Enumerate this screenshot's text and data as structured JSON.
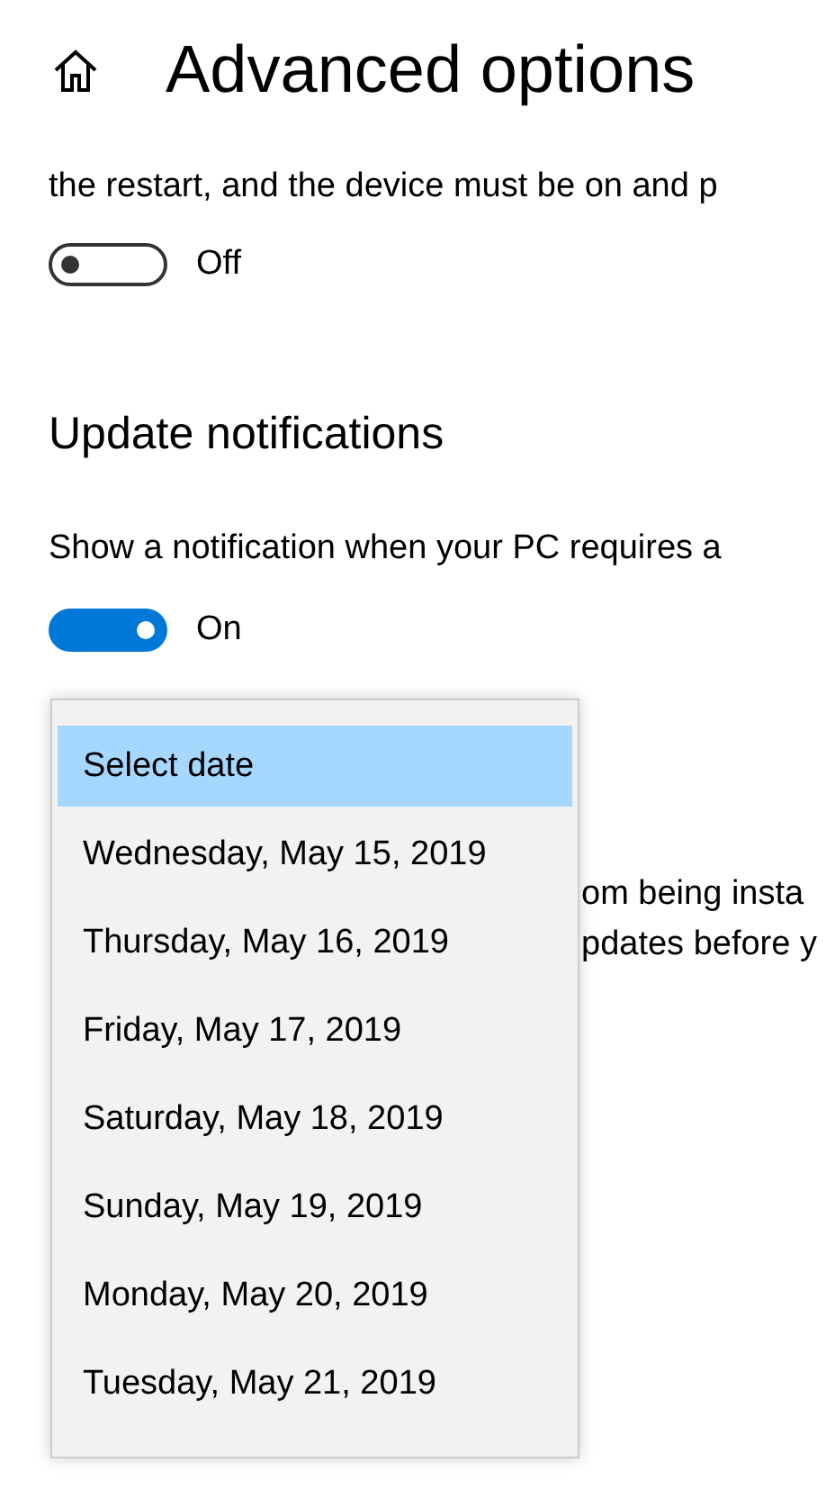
{
  "header": {
    "title": "Advanced options"
  },
  "restart_section": {
    "lines": [
      "the restart, and the device must be on and p"
    ],
    "toggle": {
      "on": false,
      "label": "Off"
    }
  },
  "notifications_section": {
    "heading": "Update notifications",
    "description": "Show a notification when your PC requires a",
    "toggle": {
      "on": true,
      "label": "On"
    }
  },
  "partial_lines": [
    "om being insta",
    "pdates before y"
  ],
  "date_dropdown": {
    "options": [
      {
        "label": "Select date",
        "selected": true
      },
      {
        "label": "Wednesday, May 15, 2019",
        "selected": false
      },
      {
        "label": "Thursday, May 16, 2019",
        "selected": false
      },
      {
        "label": "Friday, May 17, 2019",
        "selected": false
      },
      {
        "label": "Saturday, May 18, 2019",
        "selected": false
      },
      {
        "label": "Sunday, May 19, 2019",
        "selected": false
      },
      {
        "label": "Monday, May 20, 2019",
        "selected": false
      },
      {
        "label": "Tuesday, May 21, 2019",
        "selected": false
      }
    ]
  }
}
